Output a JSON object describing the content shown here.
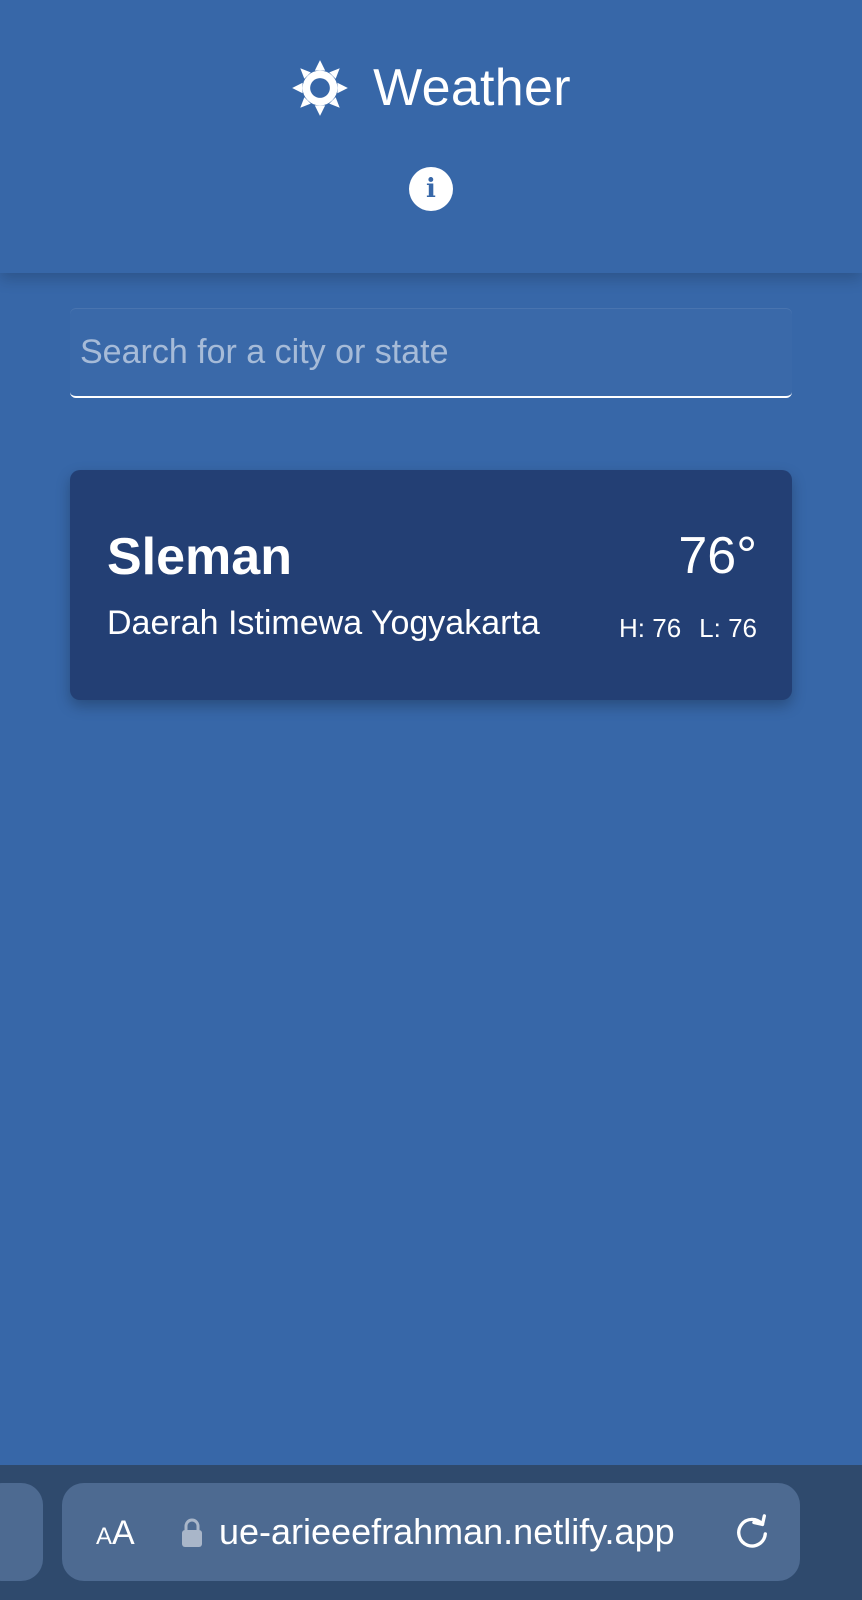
{
  "header": {
    "app_title": "Weather",
    "sun_icon": "sun-icon",
    "info_icon": "info-icon",
    "info_glyph": "i"
  },
  "search": {
    "placeholder": "Search for a city or state",
    "value": ""
  },
  "saved_cities": [
    {
      "name": "Sleman",
      "region": "Daerah Istimewa Yogyakarta",
      "temp": "76°",
      "high": "H: 76",
      "low": "L: 76"
    }
  ],
  "browser": {
    "text_size_label_small": "A",
    "text_size_label_large": "A",
    "lock_icon": "lock-icon",
    "url": "ue-arieeefrahman.netlify.app",
    "reload_icon": "reload-icon"
  },
  "colors": {
    "background": "#3767a8",
    "card": "#233f74",
    "browser_bar": "#2f4a6d",
    "url_pill": "#4d6a91",
    "text": "#ffffff"
  }
}
